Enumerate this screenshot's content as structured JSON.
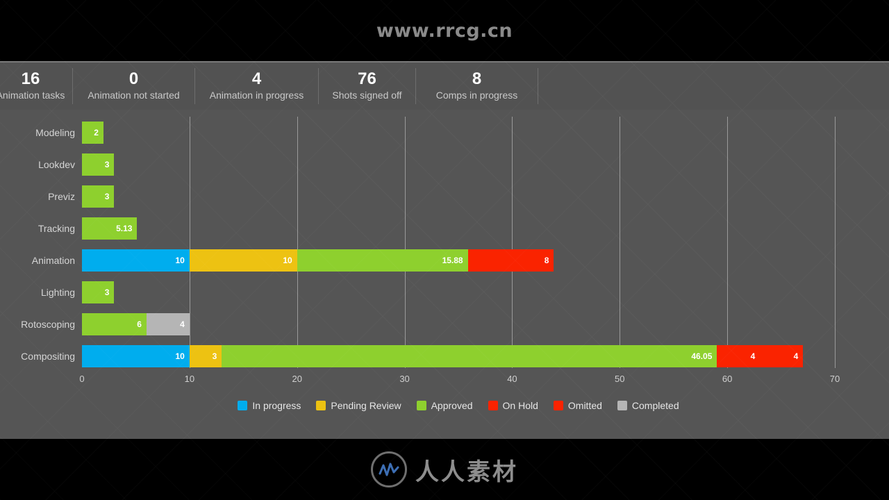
{
  "watermarks": {
    "top": "www.rrcg.cn",
    "bottom": "人人素材"
  },
  "stats": [
    {
      "value": "16",
      "label": "Animation tasks"
    },
    {
      "value": "0",
      "label": "Animation not started"
    },
    {
      "value": "4",
      "label": "Animation in progress"
    },
    {
      "value": "76",
      "label": "Shots signed off"
    },
    {
      "value": "8",
      "label": "Comps in progress"
    }
  ],
  "colors": {
    "in_progress": "#00adee",
    "pending_review": "#edc212",
    "approved": "#8ed02e",
    "on_hold": "#fa2300",
    "omitted": "#fa2300",
    "completed": "#b5b5b5",
    "panel_background": "#555555",
    "header_background": "#525252",
    "gridline": "#9a9a9a",
    "text": "#d5d5d5"
  },
  "chart_data": {
    "type": "bar",
    "orientation": "horizontal",
    "stacked": true,
    "title": "",
    "xlabel": "",
    "ylabel": "",
    "xlim": [
      0,
      70
    ],
    "xticks": [
      "0",
      "10",
      "20",
      "30",
      "40",
      "50",
      "60",
      "70"
    ],
    "grid": true,
    "legend_position": "bottom",
    "categories": [
      "Modeling",
      "Lookdev",
      "Previz",
      "Tracking",
      "Animation",
      "Lighting",
      "Rotoscoping",
      "Compositing"
    ],
    "series": [
      {
        "name": "In progress",
        "color": "#00adee",
        "values": [
          0,
          0,
          0,
          0,
          10,
          0,
          0,
          10
        ]
      },
      {
        "name": "Pending Review",
        "color": "#edc212",
        "values": [
          0,
          0,
          0,
          0,
          10,
          0,
          0,
          3
        ]
      },
      {
        "name": "Approved",
        "color": "#8ed02e",
        "values": [
          2,
          3,
          3,
          5.13,
          15.88,
          3,
          6,
          46.05
        ]
      },
      {
        "name": "On Hold",
        "color": "#fa2300",
        "values": [
          0,
          0,
          0,
          0,
          8,
          0,
          0,
          4
        ]
      },
      {
        "name": "Omitted",
        "color": "#fa2300",
        "values": [
          0,
          0,
          0,
          0,
          0,
          0,
          0,
          4
        ]
      },
      {
        "name": "Completed",
        "color": "#b5b5b5",
        "values": [
          0,
          0,
          0,
          0,
          0,
          0,
          4,
          0
        ]
      }
    ],
    "bar_labels": [
      [
        {
          "series": "Approved",
          "text": "2"
        }
      ],
      [
        {
          "series": "Approved",
          "text": "3"
        }
      ],
      [
        {
          "series": "Approved",
          "text": "3"
        }
      ],
      [
        {
          "series": "Approved",
          "text": "5.13"
        }
      ],
      [
        {
          "series": "In progress",
          "text": "10"
        },
        {
          "series": "Pending Review",
          "text": "10"
        },
        {
          "series": "Approved",
          "text": "15.88"
        },
        {
          "series": "On Hold",
          "text": "8"
        }
      ],
      [
        {
          "series": "Approved",
          "text": "3"
        }
      ],
      [
        {
          "series": "Approved",
          "text": "6"
        },
        {
          "series": "Completed",
          "text": "4"
        }
      ],
      [
        {
          "series": "In progress",
          "text": "10"
        },
        {
          "series": "Pending Review",
          "text": "3"
        },
        {
          "series": "Approved",
          "text": "46.05"
        },
        {
          "series": "On Hold",
          "text": "4"
        },
        {
          "series": "Omitted",
          "text": "4"
        }
      ]
    ]
  }
}
